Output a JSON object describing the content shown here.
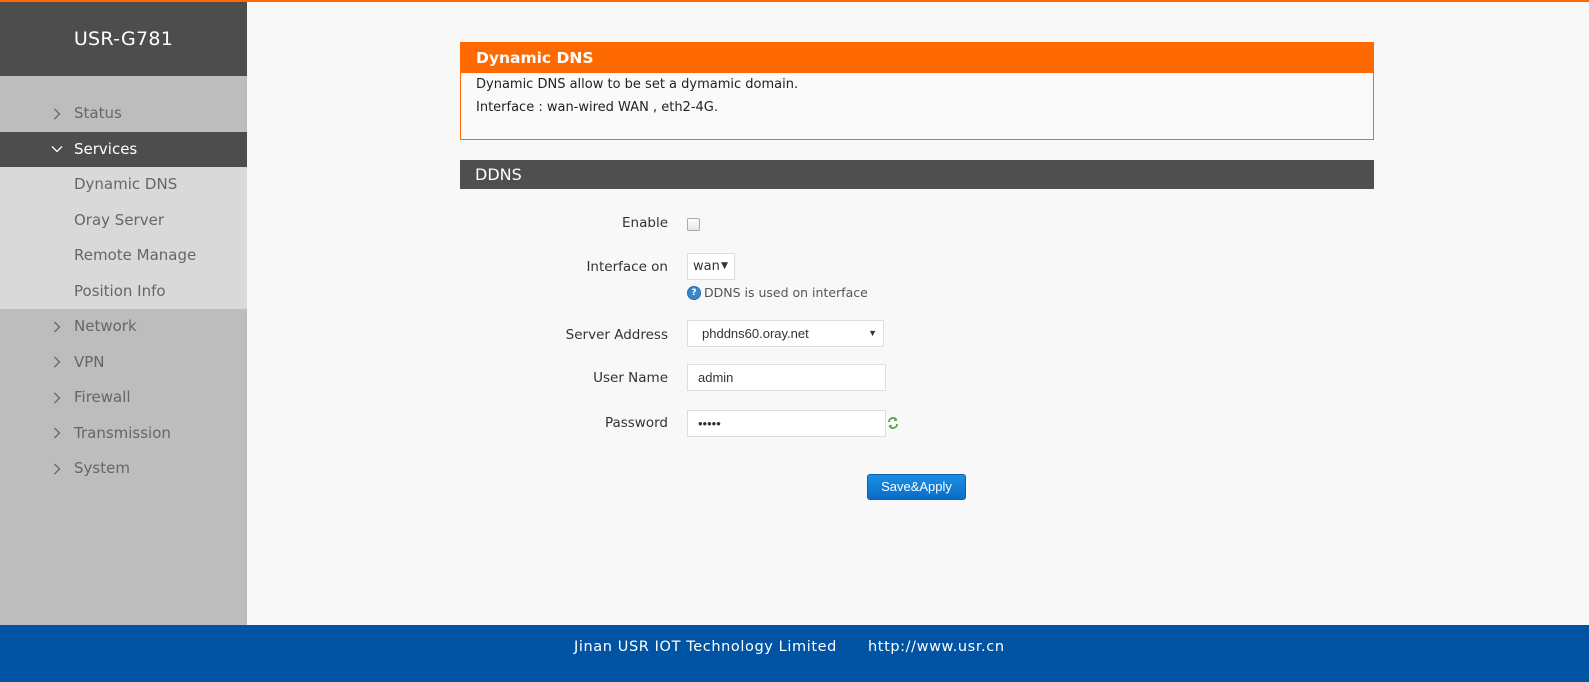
{
  "app": {
    "device_name": "USR-G781"
  },
  "colors": {
    "accent": "#ff6a00",
    "sidebar_dark": "#4d4d4d",
    "footer": "#0154a4",
    "button": "#0a6cc7"
  },
  "sidebar": {
    "items": [
      {
        "label": "Status",
        "icon": "chevron-right-icon",
        "expanded": false
      },
      {
        "label": "Services",
        "icon": "chevron-down-icon",
        "expanded": true,
        "active": true,
        "children": [
          {
            "label": "Dynamic DNS"
          },
          {
            "label": "Oray Server"
          },
          {
            "label": "Remote Manage"
          },
          {
            "label": "Position Info"
          }
        ]
      },
      {
        "label": "Network",
        "icon": "chevron-right-icon",
        "expanded": false
      },
      {
        "label": "VPN",
        "icon": "chevron-right-icon",
        "expanded": false
      },
      {
        "label": "Firewall",
        "icon": "chevron-right-icon",
        "expanded": false
      },
      {
        "label": "Transmission",
        "icon": "chevron-right-icon",
        "expanded": false
      },
      {
        "label": "System",
        "icon": "chevron-right-icon",
        "expanded": false
      }
    ]
  },
  "info": {
    "title": "Dynamic DNS",
    "lines": [
      "Dynamic DNS allow to be set a dymamic domain.",
      "Interface : wan-wired WAN , eth2-4G."
    ]
  },
  "section": {
    "title": "DDNS"
  },
  "form": {
    "enable": {
      "label": "Enable",
      "checked": false
    },
    "interface": {
      "label": "Interface on",
      "value": "wan",
      "help": "DDNS is used on interface",
      "help_icon": "question-icon"
    },
    "server": {
      "label": "Server Address",
      "value": "phddns60.oray.net"
    },
    "username": {
      "label": "User Name",
      "value": "admin"
    },
    "password": {
      "label": "Password",
      "value": "•••••",
      "reveal_icon": "refresh-icon"
    },
    "save_label": "Save&Apply"
  },
  "footer": {
    "company": "Jinan USR IOT Technology Limited",
    "url": "http://www.usr.cn"
  }
}
